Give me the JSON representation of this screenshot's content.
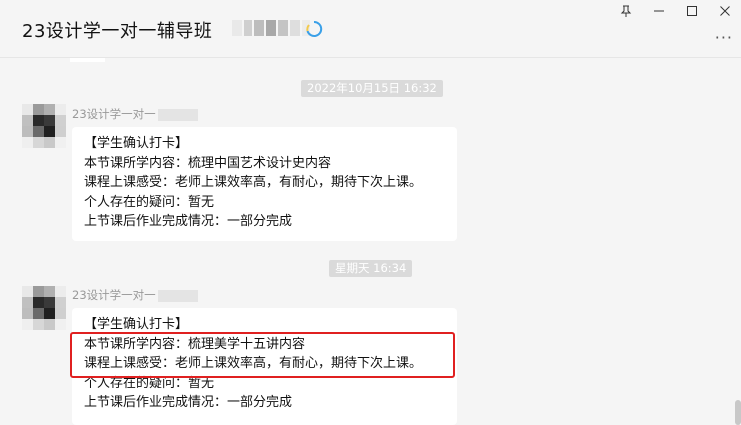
{
  "window": {
    "title": "23设计学一对一辅导班",
    "controls": [
      "pin-icon",
      "minimize-icon",
      "maximize-icon",
      "close-icon"
    ],
    "more_label": "···"
  },
  "messages": [
    {
      "timestamp": "2022年10月15日 16:32",
      "sender": "23设计学一对一",
      "lines": [
        "【学生确认打卡】",
        "本节课所学内容：梳理中国艺术设计史内容",
        "课程上课感受：老师上课效率高，有耐心，期待下次上课。",
        "个人存在的疑问：暂无",
        "上节课后作业完成情况：一部分完成"
      ]
    },
    {
      "timestamp": "星期天 16:34",
      "sender": "23设计学一对一",
      "lines": [
        "【学生确认打卡】",
        "本节课所学内容：梳理美学十五讲内容",
        "课程上课感受：老师上课效率高，有耐心，期待下次上课。",
        "个人存在的疑问：暂无",
        "上节课后作业完成情况：一部分完成"
      ]
    }
  ],
  "colors": {
    "background": "#f5f5f5",
    "bubble": "#ffffff",
    "highlight": "#e02020",
    "timestamp_bg": "#dadada"
  }
}
